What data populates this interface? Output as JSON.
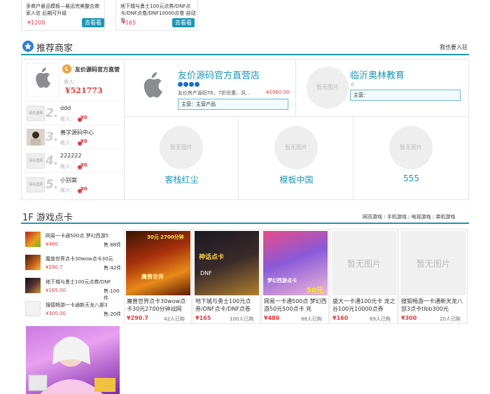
{
  "top_cards": [
    {
      "desc": "多商户悬迅模板—悬迅完美整合商家入驻 后期可升级",
      "price": "¥1200",
      "btn": "去看看"
    },
    {
      "desc": "地下城与勇士100元点券/DNF点卡/DNF点卷/DNF10000点卷 自动充",
      "price": "¥165",
      "btn": "去看看"
    }
  ],
  "recommend": {
    "title": "推荐商家",
    "join": "我也要入驻",
    "top_shop": {
      "badge": "L",
      "name": "友价源码官方直营",
      "income_label": "收入：",
      "income": "¥521773"
    },
    "ranks": [
      {
        "num": "2.",
        "logo": "请先选择",
        "name": "ddd",
        "income_label": "收入：",
        "income": "¥0"
      },
      {
        "num": "3.",
        "logo": "",
        "name": "善学源码中心",
        "income_label": "收入：",
        "income": "¥0"
      },
      {
        "num": "4.",
        "logo": "请先选择",
        "name": "222222",
        "income_label": "收入：",
        "income": "¥0"
      },
      {
        "num": "5.",
        "logo": "请先选择",
        "name": "小别窝",
        "income_label": "收入：",
        "income": "¥0"
      }
    ],
    "featured": {
      "name": "友价源码官方直营店",
      "desc": "友价房产源码T6，7折优惠，风...",
      "price": "¥1960.00",
      "main": "主营：主营产品"
    },
    "linyi": {
      "nophoto": "暂无图片",
      "name": "临沂奥林教育",
      "main": "主营："
    },
    "shops": [
      {
        "nophoto": "暂无图片",
        "name": "客栈红尘"
      },
      {
        "nophoto": "暂无图片",
        "name": "模板中国"
      },
      {
        "nophoto": "暂无图片",
        "name": "555"
      }
    ]
  },
  "floor": {
    "title": "1F 游戏点卡",
    "links": [
      "网页游戏",
      "手机游戏",
      "电视游戏",
      "单机游戏"
    ],
    "sep": "/",
    "list": [
      {
        "name": "网易一卡通500点 梦幻西游5",
        "price": "¥480",
        "sales": "售:88件"
      },
      {
        "name": "魔兽世界点卡30wow点卡30元",
        "price": "¥290.7",
        "sales": "售:42件"
      },
      {
        "name": "地下城与勇士100元点券/DNF",
        "price": "¥165.00",
        "sales": "售:100件"
      },
      {
        "name": "搜狐畅游一卡通新天龙八部3",
        "price": "¥300.00",
        "sales": "售:20件"
      }
    ],
    "products": [
      {
        "title": "魔兽世界点卡30wow点卡30元2700分钟战网",
        "price": "¥290.7",
        "buyers": "42人已购",
        "img_text": "魔兽世界",
        "img_sub": "30元 2700分钟"
      },
      {
        "title": "地下城与勇士100元点券/DNF点卡/DNF点卷",
        "price": "¥165",
        "buyers": "100人已购",
        "img_text": "神话点卡",
        "img_sub": "DNF"
      },
      {
        "title": "网易一卡通500点 梦幻西游50元500点卡 充",
        "price": "¥480",
        "buyers": "88人已购",
        "img_text": "梦幻西游点卡",
        "img_sub": "50元"
      },
      {
        "title": "盛大一卡通100元卡 龙之谷100元10000点券",
        "price": "¥160",
        "buyers": "69人已购",
        "img_text": "暂无图片",
        "img_sub": ""
      },
      {
        "title": "搜狐畅游一卡通新天龙八部3点卡tlbb300元",
        "price": "¥300",
        "buyers": "20人已购",
        "img_text": "暂无图片",
        "img_sub": ""
      }
    ]
  }
}
